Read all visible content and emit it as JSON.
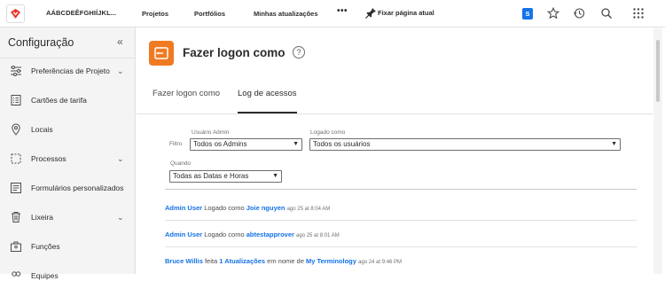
{
  "topbar": {
    "org_name": "AÁBCDEÊFGHIÍJKL...",
    "nav": [
      "Projetos",
      "Portfólios",
      "Minhas atualizações"
    ],
    "more": "•••",
    "pin_label": "Fixar página atual",
    "user_badge": "S",
    "colors": {
      "brand": "#e8352b",
      "badge": "#1473e6"
    }
  },
  "sidebar": {
    "title": "Configuração",
    "collapse_glyph": "«",
    "items": [
      {
        "label": "Preferências de Projeto",
        "icon": "sliders-icon",
        "expandable": true
      },
      {
        "label": "Cartões de tarifa",
        "icon": "card-icon",
        "expandable": false
      },
      {
        "label": "Locais",
        "icon": "location-pin-icon",
        "expandable": false
      },
      {
        "label": "Processos",
        "icon": "process-icon",
        "expandable": true
      },
      {
        "label": "Formulários personalizados",
        "icon": "form-icon",
        "expandable": false
      },
      {
        "label": "Lixeira",
        "icon": "trash-icon",
        "expandable": true
      },
      {
        "label": "Funções",
        "icon": "roles-icon",
        "expandable": false
      },
      {
        "label": "Equipes",
        "icon": "team-icon",
        "expandable": false
      }
    ]
  },
  "page": {
    "title": "Fazer logon como",
    "help": "?",
    "icon_color": "#f07a22",
    "tabs": [
      {
        "label": "Fazer logon como",
        "active": false
      },
      {
        "label": "Log de acessos",
        "active": true
      }
    ]
  },
  "filters": {
    "filter_label": "Filtro",
    "admin_label": "Usuário Admin",
    "admin_value": "Todos os Admins",
    "logged_label": "Logado como",
    "logged_value": "Todos os usuários",
    "when_label": "Quando",
    "when_value": "Todas as Datas e Horas"
  },
  "log": [
    {
      "actor": "Admin User",
      "action": "Logado como",
      "target": "Joie nguyen",
      "middle": "",
      "extra": "",
      "time": "ago 25 at 8:04 AM"
    },
    {
      "actor": "Admin User",
      "action": "Logado como",
      "target": "abtestapprover",
      "middle": "",
      "extra": "",
      "time": "ago 25 at 8:01 AM"
    },
    {
      "actor": "Bruce Willis",
      "action": "feita",
      "target": "1 Atualizações",
      "middle": "em nome de",
      "extra": "My Terminology",
      "time": "ago 24 at 9:46 PM"
    }
  ]
}
